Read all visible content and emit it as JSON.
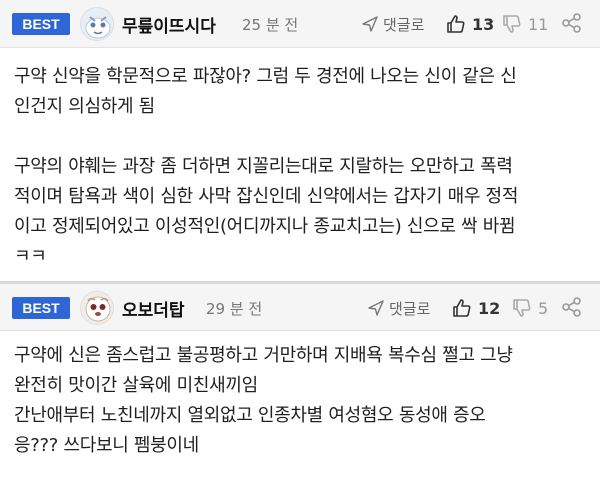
{
  "comments": [
    {
      "badge": "BEST",
      "username": "무릎이뜨시다",
      "time": "25 분 전",
      "reply_label": "댓글로",
      "likes": "13",
      "dislikes": "11",
      "paragraphs": [
        [
          "구약 신약을 학문적으로 파잖아? 그럼 두 경전에 나오는 신이 같은 신",
          "인건지 의심하게 됨"
        ],
        [
          "구약의 야훼는 과장 좀 더하면 지꼴리는대로 지랄하는 오만하고 폭력",
          "적이며 탐욕과 색이 심한 사막 잡신인데 신약에서는 갑자기 매우 정적",
          "이고 정제되어있고 이성적인(어디까지나 종교치고는) 신으로 싹 바뀜",
          "ㅋㅋ"
        ]
      ]
    },
    {
      "badge": "BEST",
      "username": "오보더탑",
      "time": "29 분 전",
      "reply_label": "댓글로",
      "likes": "12",
      "dislikes": "5",
      "paragraphs": [
        [
          "구약에 신은 좀스럽고 불공평하고 거만하며 지배욕 복수심 쩔고 그냥",
          "완전히 맛이간 살육에 미친새끼임",
          "간난애부터 노친네까지 열외없고 인종차별 여성혐오 동성애 증오",
          "응??? 쓰다보니 펨붕이네"
        ]
      ]
    }
  ],
  "colors": {
    "badge_bg": "#2f66d6",
    "header_bg": "#f5f5f5",
    "meta_text": "#777777"
  },
  "icons": {
    "reply": "send-arrow-icon",
    "like": "thumbs-up-icon",
    "dislike": "thumbs-down-icon",
    "share": "share-icon"
  }
}
